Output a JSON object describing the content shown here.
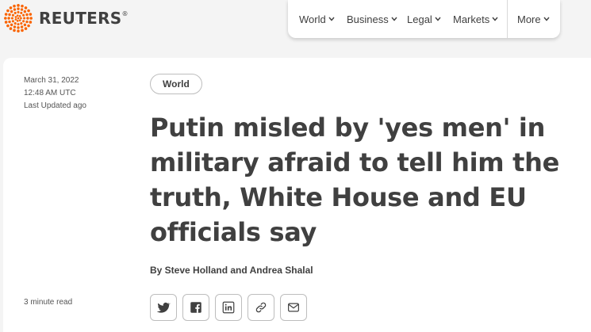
{
  "brand": {
    "name": "REUTERS",
    "mark": "®",
    "accent": "#fa6400"
  },
  "nav": {
    "items": [
      {
        "label": "World"
      },
      {
        "label": "Business"
      },
      {
        "label": "Legal"
      },
      {
        "label": "Markets"
      },
      {
        "label": "More"
      }
    ]
  },
  "article": {
    "date": "March 31, 2022",
    "time": "12:48 AM UTC",
    "updated": "Last Updated ago",
    "tag": "World",
    "headline": "Putin misled by 'yes men' in military afraid to tell him the truth, White House and EU officials say",
    "byline": "By Steve Holland and Andrea Shalal",
    "read_time": "3 minute read"
  },
  "share": {
    "buttons": [
      {
        "icon": "twitter-icon"
      },
      {
        "icon": "facebook-icon"
      },
      {
        "icon": "linkedin-icon"
      },
      {
        "icon": "link-icon"
      },
      {
        "icon": "email-icon"
      }
    ]
  }
}
